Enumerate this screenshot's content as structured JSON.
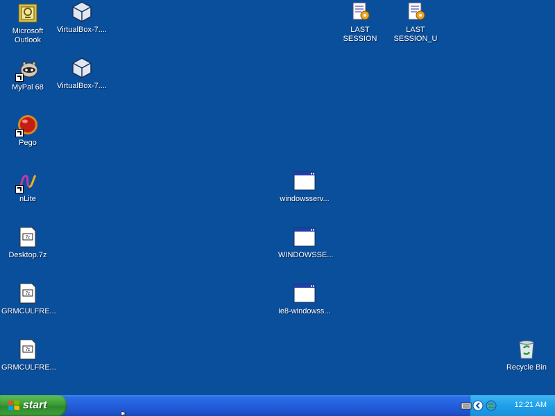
{
  "desktop": {
    "icons": [
      {
        "label_html": "Microsoft Outlook",
        "label": "Microsoft Outlook"
      },
      {
        "label": "VirtualBox-7...."
      },
      {
        "label": "LAST SESSION"
      },
      {
        "label": "LAST SESSION_U"
      },
      {
        "label": "MyPal 68"
      },
      {
        "label": "VirtualBox-7...."
      },
      {
        "label": "Pego"
      },
      {
        "label": "nLite"
      },
      {
        "label": "windowsserv..."
      },
      {
        "label": "Desktop.7z"
      },
      {
        "label": "WINDOWSSE..."
      },
      {
        "label": "GRMCULFRE..."
      },
      {
        "label": "ie8-windowss..."
      },
      {
        "label": "GRMCULFRE..."
      },
      {
        "label": "Recycle Bin"
      }
    ]
  },
  "taskbar": {
    "start_label": "start",
    "clock": "12:21 AM"
  },
  "colors": {
    "desktop_bg": "#0a4f9c",
    "taskbar_blue": "#245edb",
    "start_green": "#3c9d34",
    "tray_blue": "#1ea0ea"
  }
}
